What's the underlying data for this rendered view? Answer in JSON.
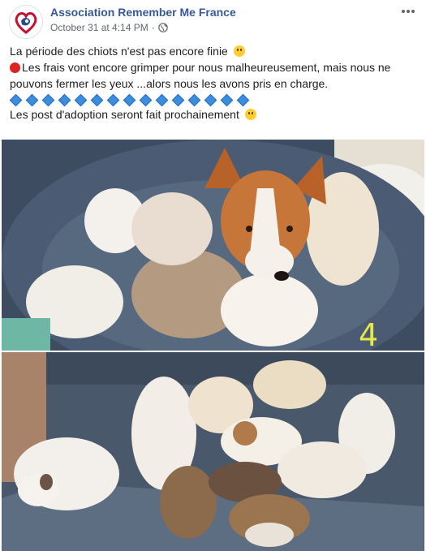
{
  "post": {
    "page_name": "Association Remember Me France",
    "timestamp": "October 31 at 4:14 PM",
    "separator": "·",
    "privacy_icon": "globe-icon",
    "more_icon": "more-options-icon"
  },
  "text": {
    "line1": "La période des chiots n'est pas encore finie",
    "line1_emoji": "sad-face-emoji",
    "line2": "Les frais vont encore grimper pour nous malheureusement, mais nous ne pouvons fermer les yeux ...alors nous les avons pris en charge.",
    "line2_emoji": "red-circle-emoji",
    "diamond_emoji": "blue-diamond-emoji",
    "diamond_count": 15,
    "line4": "Les post d'adoption seront fait prochainement",
    "line4_emoji": "smile-emoji"
  },
  "photos": [
    {
      "subject": "corgi-mother-with-puppies",
      "label": "4"
    },
    {
      "subject": "puppies-litter-on-blanket",
      "label": ""
    }
  ],
  "colors": {
    "link": "#385898",
    "meta": "#616770",
    "text": "#1c1e21",
    "diamond": "#3b8de0",
    "red_dot": "#e02020"
  }
}
